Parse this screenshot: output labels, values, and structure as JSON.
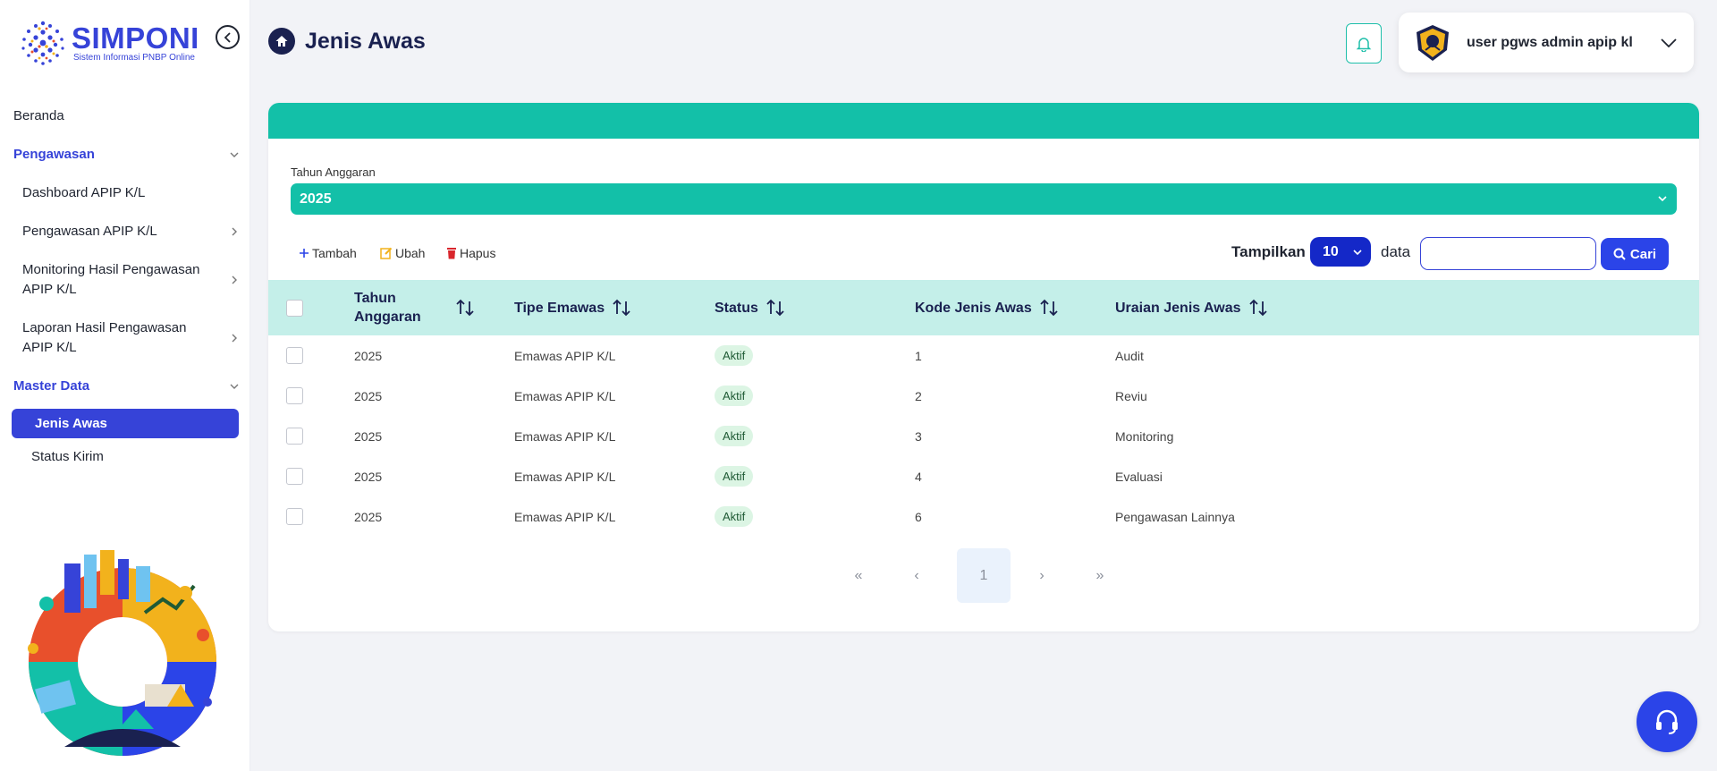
{
  "brand": {
    "name": "SIMPONI",
    "tagline": "Sistem Informasi PNBP Online",
    "color": "#3643d8"
  },
  "sidebar": {
    "items": [
      {
        "label": "Beranda"
      },
      {
        "label": "Pengawasan"
      },
      {
        "label": "Dashboard APIP K/L"
      },
      {
        "label": "Pengawasan APIP K/L"
      },
      {
        "label": "Monitoring Hasil Pengawasan APIP K/L"
      },
      {
        "label": "Laporan Hasil Pengawasan APIP K/L"
      },
      {
        "label": "Master Data"
      },
      {
        "label": "Jenis Awas"
      },
      {
        "label": "Status Kirim"
      }
    ],
    "active_item": "Jenis Awas"
  },
  "header": {
    "title": "Jenis Awas",
    "user_name": "user pgws admin apip kl"
  },
  "filter": {
    "label": "Tahun Anggaran",
    "value": "2025"
  },
  "toolbar": {
    "add_label": "Tambah",
    "edit_label": "Ubah",
    "delete_label": "Hapus"
  },
  "list_controls": {
    "show_label": "Tampilkan",
    "page_size": "10",
    "data_label": "data",
    "search_placeholder": "",
    "search_value": "",
    "search_button": "Cari"
  },
  "table": {
    "columns": [
      "Tahun Anggaran",
      "Tipe Emawas",
      "Status",
      "Kode Jenis Awas",
      "Uraian Jenis Awas"
    ],
    "rows": [
      {
        "tahun": "2025",
        "tipe": "Emawas APIP K/L",
        "status": "Aktif",
        "kode": "1",
        "uraian": "Audit"
      },
      {
        "tahun": "2025",
        "tipe": "Emawas APIP K/L",
        "status": "Aktif",
        "kode": "2",
        "uraian": "Reviu"
      },
      {
        "tahun": "2025",
        "tipe": "Emawas APIP K/L",
        "status": "Aktif",
        "kode": "3",
        "uraian": "Monitoring"
      },
      {
        "tahun": "2025",
        "tipe": "Emawas APIP K/L",
        "status": "Aktif",
        "kode": "4",
        "uraian": "Evaluasi"
      },
      {
        "tahun": "2025",
        "tipe": "Emawas APIP K/L",
        "status": "Aktif",
        "kode": "6",
        "uraian": "Pengawasan Lainnya"
      }
    ]
  },
  "pagination": {
    "first": "«",
    "prev": "‹",
    "current": "1",
    "next": "›",
    "last": "»"
  },
  "colors": {
    "primary": "#3643d8",
    "teal": "#13c0a8",
    "header_row": "#c4efe9",
    "badge_bg": "#dcf5e4",
    "button_blue": "#2b44e8"
  }
}
